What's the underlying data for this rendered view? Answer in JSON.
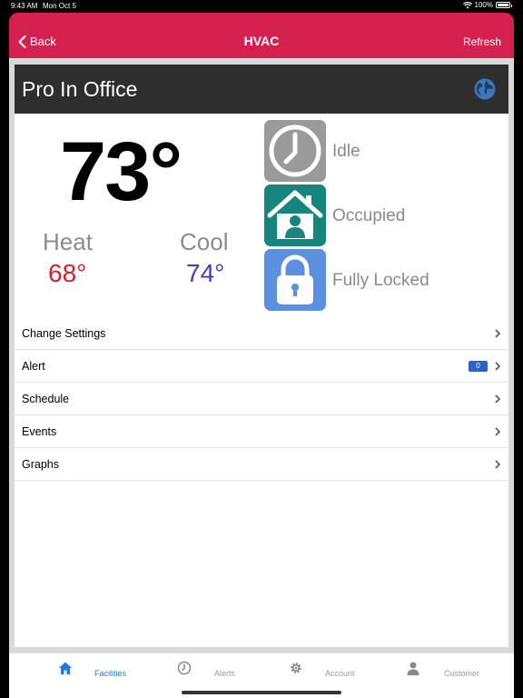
{
  "status_bar": {
    "time": "9:43 AM",
    "date": "Mon Oct 5",
    "battery": "100%",
    "battery_level": 1.0
  },
  "nav": {
    "back_label": "Back",
    "title": "HVAC",
    "refresh_label": "Refresh",
    "accent_color": "#d6204f"
  },
  "device": {
    "name": "Pro In Office",
    "current_temp": "73°",
    "heat_label": "Heat",
    "heat_value": "68°",
    "cool_label": "Cool",
    "cool_value": "74°"
  },
  "statuses": [
    {
      "icon": "clock-icon",
      "label": "Idle",
      "color": "#9a9a9a"
    },
    {
      "icon": "house-person-icon",
      "label": "Occupied",
      "color": "#16857d"
    },
    {
      "icon": "lock-icon",
      "label": "Fully Locked",
      "color": "#5b8fe0"
    }
  ],
  "menu": [
    {
      "label": "Change Settings"
    },
    {
      "label": "Alert",
      "badge": "0"
    },
    {
      "label": "Schedule"
    },
    {
      "label": "Events"
    },
    {
      "label": "Graphs"
    }
  ],
  "tabs": [
    {
      "label": "Facilities",
      "icon": "home-icon",
      "active": true
    },
    {
      "label": "Alerts",
      "icon": "clock-icon",
      "active": false
    },
    {
      "label": "Account",
      "icon": "gear-icon",
      "active": false
    },
    {
      "label": "Customer",
      "icon": "person-icon",
      "active": false
    }
  ]
}
